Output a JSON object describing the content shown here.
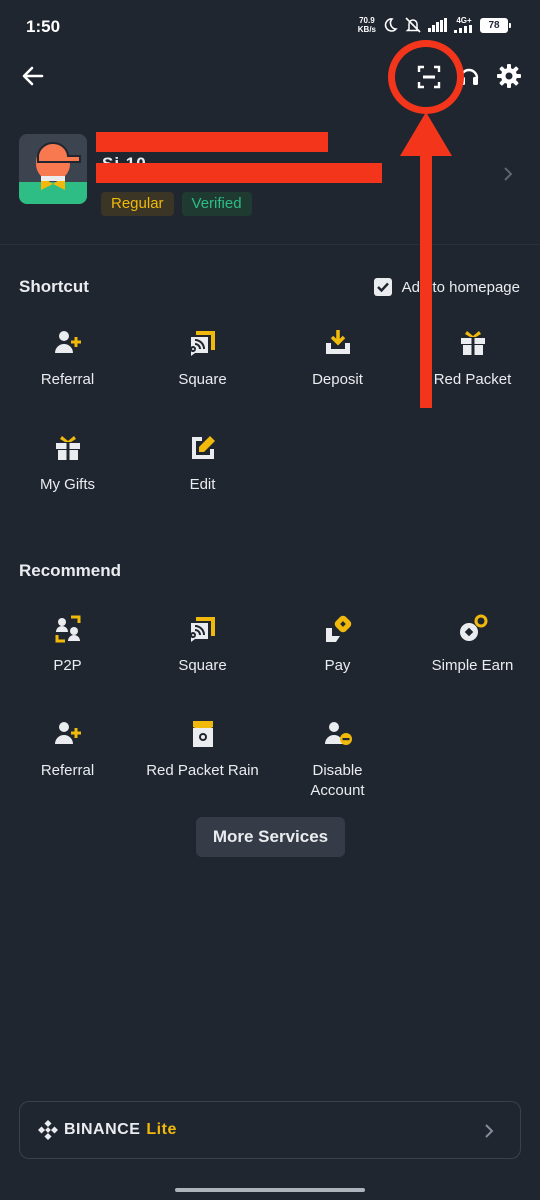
{
  "status_bar": {
    "time": "1:50",
    "net_speed_value": "70.9",
    "net_speed_unit": "KB/s",
    "network": "4G+",
    "battery": "78"
  },
  "header": {
    "back_icon": "arrow-left-icon",
    "scan_icon": "scan-icon",
    "support_icon": "headset-icon",
    "settings_icon": "gear-icon"
  },
  "profile": {
    "username_visible": "Si          10",
    "badges": [
      "Regular",
      "Verified"
    ],
    "colors": {
      "regular": "#f0b90b",
      "verified": "#2ebd85"
    }
  },
  "shortcut": {
    "title": "Shortcut",
    "add_to_homepage": "Add to homepage",
    "add_to_homepage_checked": true,
    "items": [
      {
        "label": "Referral",
        "icon": "add-user-icon"
      },
      {
        "label": "Square",
        "icon": "square-broadcast-icon"
      },
      {
        "label": "Deposit",
        "icon": "download-icon"
      },
      {
        "label": "Red Packet",
        "icon": "gift-icon"
      },
      {
        "label": "My Gifts",
        "icon": "gift-icon"
      },
      {
        "label": "Edit",
        "icon": "edit-icon"
      }
    ]
  },
  "recommend": {
    "title": "Recommend",
    "items": [
      {
        "label": "P2P",
        "icon": "p2p-icon"
      },
      {
        "label": "Square",
        "icon": "square-broadcast-icon"
      },
      {
        "label": "Pay",
        "icon": "pay-icon"
      },
      {
        "label": "Simple Earn",
        "icon": "simple-earn-icon"
      },
      {
        "label": "Referral",
        "icon": "add-user-icon"
      },
      {
        "label": "Red Packet Rain",
        "icon": "red-packet-rain-icon"
      },
      {
        "label": "Disable Account",
        "icon": "disable-account-icon"
      }
    ]
  },
  "more_services": "More Services",
  "binance_lite": {
    "brand": "BINANCE",
    "lite": "Lite"
  },
  "accent_color": "#f0b90b",
  "annotation_color": "#f3351b"
}
